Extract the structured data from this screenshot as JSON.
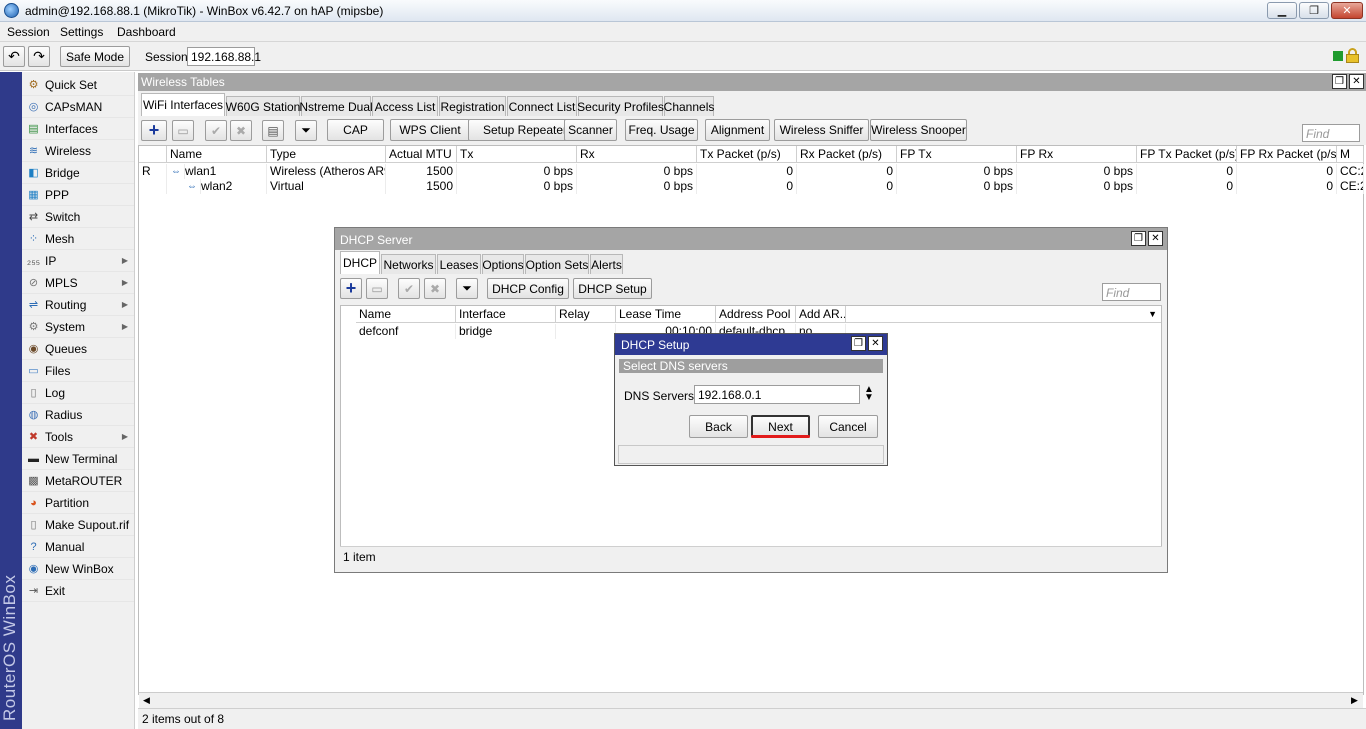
{
  "window": {
    "title": "admin@192.168.88.1 (MikroTik) - WinBox v6.42.7 on hAP (mipsbe)",
    "minimize": "▁",
    "maximize": "❐",
    "close": "✕"
  },
  "menubar": [
    "Session",
    "Settings",
    "Dashboard"
  ],
  "toolbar": {
    "undo": "↶",
    "redo": "↷",
    "safe_mode": "Safe Mode",
    "session_label": "Session:",
    "session_value": "192.168.88.1"
  },
  "brand": "RouterOS WinBox",
  "sidebar": [
    {
      "label": "Quick Set",
      "icon": "quickset-icon",
      "glyph": "⚙",
      "color": "#a06a1e",
      "sub": false
    },
    {
      "label": "CAPsMAN",
      "icon": "capsman-icon",
      "glyph": "◎",
      "color": "#3b6fb5",
      "sub": false
    },
    {
      "label": "Interfaces",
      "icon": "interfaces-icon",
      "glyph": "▤",
      "color": "#2e8b3a",
      "sub": false
    },
    {
      "label": "Wireless",
      "icon": "wireless-icon",
      "glyph": "≋",
      "color": "#2c6cb5",
      "sub": false
    },
    {
      "label": "Bridge",
      "icon": "bridge-icon",
      "glyph": "◧",
      "color": "#1e7fc4",
      "sub": false
    },
    {
      "label": "PPP",
      "icon": "ppp-icon",
      "glyph": "▦",
      "color": "#1e7fc4",
      "sub": false
    },
    {
      "label": "Switch",
      "icon": "switch-icon",
      "glyph": "⇄",
      "color": "#444",
      "sub": false
    },
    {
      "label": "Mesh",
      "icon": "mesh-icon",
      "glyph": "⁘",
      "color": "#2c6cb5",
      "sub": false
    },
    {
      "label": "IP",
      "icon": "ip-icon",
      "glyph": "₂₅₅",
      "color": "#555",
      "sub": true
    },
    {
      "label": "MPLS",
      "icon": "mpls-icon",
      "glyph": "⊘",
      "color": "#777",
      "sub": true
    },
    {
      "label": "Routing",
      "icon": "routing-icon",
      "glyph": "⇌",
      "color": "#2c6cb5",
      "sub": true
    },
    {
      "label": "System",
      "icon": "system-icon",
      "glyph": "⚙",
      "color": "#777",
      "sub": true
    },
    {
      "label": "Queues",
      "icon": "queues-icon",
      "glyph": "◉",
      "color": "#6b4a2a",
      "sub": false
    },
    {
      "label": "Files",
      "icon": "files-icon",
      "glyph": "▭",
      "color": "#3f7ec4",
      "sub": false
    },
    {
      "label": "Log",
      "icon": "log-icon",
      "glyph": "▯",
      "color": "#777",
      "sub": false
    },
    {
      "label": "Radius",
      "icon": "radius-icon",
      "glyph": "◍",
      "color": "#3b6fb5",
      "sub": false
    },
    {
      "label": "Tools",
      "icon": "tools-icon",
      "glyph": "✖",
      "color": "#c0392b",
      "sub": true
    },
    {
      "label": "New Terminal",
      "icon": "terminal-icon",
      "glyph": "▬",
      "color": "#222",
      "sub": false
    },
    {
      "label": "MetaROUTER",
      "icon": "metarouter-icon",
      "glyph": "▩",
      "color": "#555",
      "sub": false
    },
    {
      "label": "Partition",
      "icon": "partition-icon",
      "glyph": "◕",
      "color": "#d9541e",
      "sub": false
    },
    {
      "label": "Make Supout.rif",
      "icon": "supout-icon",
      "glyph": "▯",
      "color": "#777",
      "sub": false
    },
    {
      "label": "Manual",
      "icon": "manual-icon",
      "glyph": "?",
      "color": "#2c6cb5",
      "sub": false
    },
    {
      "label": "New WinBox",
      "icon": "winbox-icon",
      "glyph": "◉",
      "color": "#2c6cb5",
      "sub": false
    },
    {
      "label": "Exit",
      "icon": "exit-icon",
      "glyph": "⇥",
      "color": "#555",
      "sub": false
    }
  ],
  "wireless": {
    "title": "Wireless Tables",
    "tabs": [
      "WiFi Interfaces",
      "W60G Station",
      "Nstreme Dual",
      "Access List",
      "Registration",
      "Connect List",
      "Security Profiles",
      "Channels"
    ],
    "buttons": [
      "CAP",
      "WPS Client",
      "Setup Repeater",
      "Scanner",
      "Freq. Usage",
      "Alignment",
      "Wireless Sniffer",
      "Wireless Snooper"
    ],
    "find_placeholder": "Find",
    "columns": [
      "",
      "Name",
      "Type",
      "Actual MTU",
      "Tx",
      "Rx",
      "Tx Packet (p/s)",
      "Rx Packet (p/s)",
      "FP Tx",
      "FP Rx",
      "FP Tx Packet (p/s)",
      "FP Rx Packet (p/s)",
      "M"
    ],
    "rows": [
      [
        "R",
        "wlan1",
        "Wireless (Atheros AR9...",
        "1500",
        "0 bps",
        "0 bps",
        "0",
        "0",
        "0 bps",
        "0 bps",
        "0",
        "0",
        "CC:2"
      ],
      [
        "",
        "wlan2",
        "Virtual",
        "1500",
        "0 bps",
        "0 bps",
        "0",
        "0",
        "0 bps",
        "0 bps",
        "0",
        "0",
        "CE:2"
      ]
    ],
    "status": "2 items out of 8"
  },
  "dhcp": {
    "title": "DHCP Server",
    "tabs": [
      "DHCP",
      "Networks",
      "Leases",
      "Options",
      "Option Sets",
      "Alerts"
    ],
    "buttons": [
      "DHCP Config",
      "DHCP Setup"
    ],
    "find_placeholder": "Find",
    "columns": [
      "Name",
      "Interface",
      "Relay",
      "Lease Time",
      "Address Pool",
      "Add AR..."
    ],
    "rows": [
      [
        "defconf",
        "bridge",
        "",
        "00:10:00",
        "default-dhcp",
        "no"
      ]
    ],
    "status": "1 item"
  },
  "setup": {
    "title": "DHCP Setup",
    "section": "Select DNS servers",
    "dns_label": "DNS Servers:",
    "dns_value": "192.168.0.1",
    "back": "Back",
    "next": "Next",
    "cancel": "Cancel"
  },
  "colors": {
    "accent_red": "#e21b1b",
    "dialog_title": "#2e3a93",
    "brand_bar": "#2f3a8a"
  }
}
